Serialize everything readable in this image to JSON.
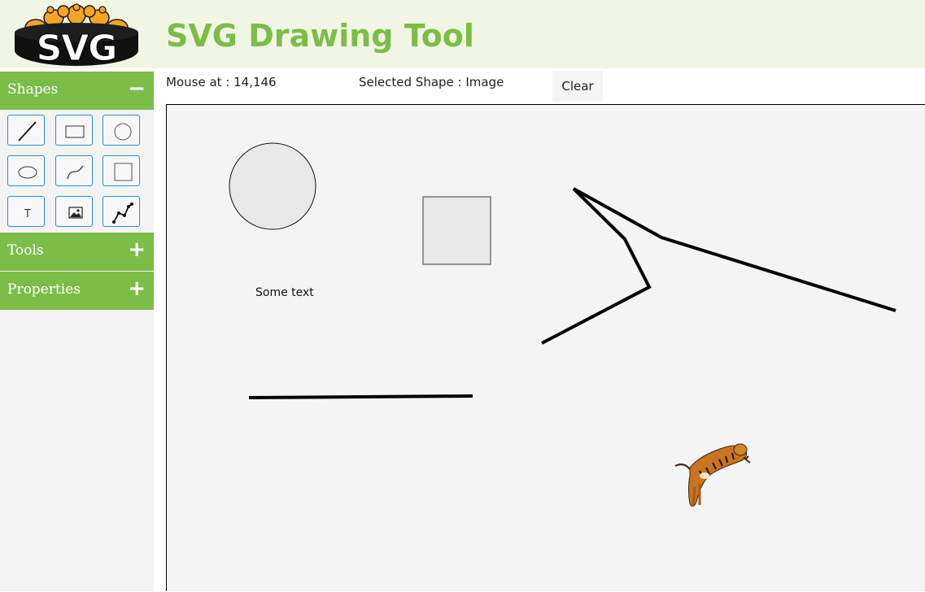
{
  "header": {
    "logo_text": "SVG",
    "title": "SVG Drawing Tool"
  },
  "sidebar": {
    "panels": [
      {
        "label": "Shapes",
        "toggle": "−",
        "expanded": true
      },
      {
        "label": "Tools",
        "toggle": "+",
        "expanded": false
      },
      {
        "label": "Properties",
        "toggle": "+",
        "expanded": false
      }
    ],
    "shape_buttons": [
      {
        "icon": "line-icon"
      },
      {
        "icon": "rectangle-icon"
      },
      {
        "icon": "circle-icon"
      },
      {
        "icon": "ellipse-icon"
      },
      {
        "icon": "curve-icon"
      },
      {
        "icon": "square-icon"
      },
      {
        "icon": "text-icon",
        "glyph": "T"
      },
      {
        "icon": "image-icon"
      },
      {
        "icon": "polyline-icon"
      }
    ]
  },
  "toolbar": {
    "mouse_position": "Mouse at : 14,146",
    "selected_shape": "Selected Shape : Image",
    "clear_label": "Clear"
  },
  "canvas": {
    "text_shape": "Some text"
  },
  "colors": {
    "accent": "#7cbd47",
    "header_bg": "#f1f6e4",
    "button_border": "#2a8fd0",
    "canvas_bg": "#f4f4f4",
    "shape_fill": "#e8e8e8"
  }
}
